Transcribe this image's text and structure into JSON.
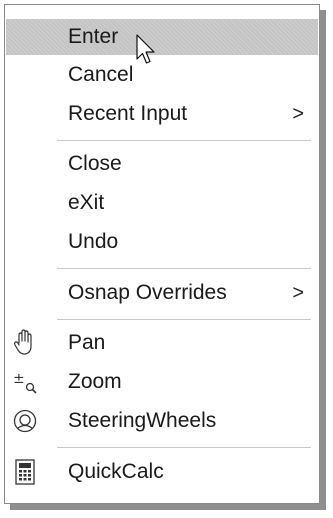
{
  "menu": {
    "items": [
      {
        "label": "Enter"
      },
      {
        "label": "Cancel"
      },
      {
        "label": "Recent Input",
        "submenu_arrow": ">"
      },
      {
        "label": "Close"
      },
      {
        "label": "eXit"
      },
      {
        "label": "Undo"
      },
      {
        "label": "Osnap Overrides",
        "submenu_arrow": ">"
      },
      {
        "label": "Pan",
        "icon": "pan-hand-icon"
      },
      {
        "label": "Zoom",
        "icon": "zoom-icon"
      },
      {
        "label": "SteeringWheels",
        "icon": "steering-wheels-icon"
      },
      {
        "label": "QuickCalc",
        "icon": "calculator-icon"
      }
    ]
  },
  "colors": {
    "highlight": "#c4c4c4",
    "separator": "#c8c8c8",
    "border": "#8a8a8a"
  }
}
